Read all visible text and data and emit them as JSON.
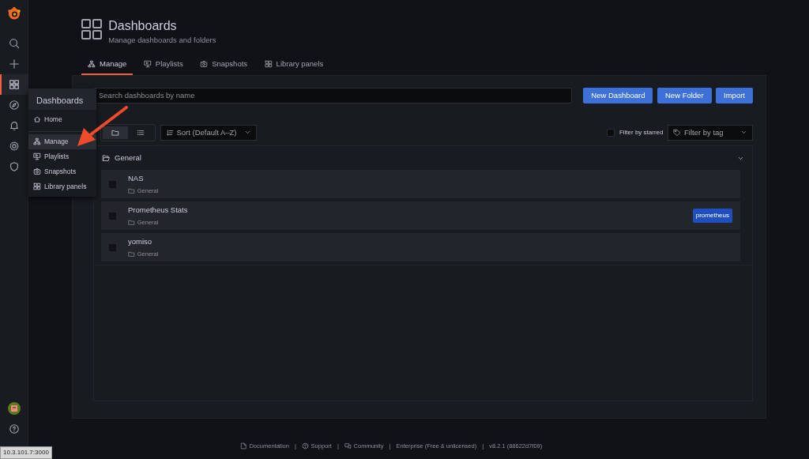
{
  "sidebar": {
    "items": [
      {
        "kind": "search",
        "selected": false
      },
      {
        "kind": "create",
        "selected": false
      },
      {
        "kind": "dashboards",
        "selected": true
      },
      {
        "kind": "explore",
        "selected": false
      },
      {
        "kind": "alerting",
        "selected": false
      },
      {
        "kind": "configuration",
        "selected": false
      },
      {
        "kind": "shield",
        "selected": false
      }
    ],
    "bottom": [
      {
        "kind": "avatar"
      },
      {
        "kind": "help"
      }
    ]
  },
  "flyout": {
    "title": "Dashboards",
    "items": [
      {
        "label": "Home",
        "kind": "home",
        "selected": false
      },
      {
        "label": "Manage",
        "kind": "manage",
        "selected": true
      },
      {
        "label": "Playlists",
        "kind": "playlists",
        "selected": false
      },
      {
        "label": "Snapshots",
        "kind": "snapshots",
        "selected": false
      },
      {
        "label": "Library panels",
        "kind": "library",
        "selected": false
      }
    ]
  },
  "page_header": {
    "title": "Dashboards",
    "subtitle": "Manage dashboards and folders"
  },
  "tabs": [
    {
      "label": "Manage",
      "kind": "manage",
      "selected": true
    },
    {
      "label": "Playlists",
      "kind": "playlists",
      "selected": false
    },
    {
      "label": "Snapshots",
      "kind": "snapshots",
      "selected": false
    },
    {
      "label": "Library panels",
      "kind": "library",
      "selected": false
    }
  ],
  "search": {
    "placeholder": "Search dashboards by name"
  },
  "buttons": [
    "New Dashboard",
    "New Folder",
    "Import"
  ],
  "view_modes": [
    {
      "kind": "folders",
      "selected": true
    },
    {
      "kind": "list",
      "selected": false
    }
  ],
  "sort": {
    "value": "Sort (Default A–Z)"
  },
  "filter_starred": {
    "label": "Filter by starred",
    "checked": false
  },
  "tag_filter": {
    "placeholder": "Filter by tag"
  },
  "folder": {
    "name": "General",
    "expanded": true,
    "dashboards": [
      {
        "title": "NAS",
        "folder": "General",
        "checked": false
      },
      {
        "title": "Prometheus Stats",
        "folder": "General",
        "checked": false,
        "tags": [
          "prometheus"
        ]
      },
      {
        "title": "yomiso",
        "folder": "General",
        "checked": false
      }
    ]
  },
  "footer": [
    {
      "label": "Documentation",
      "kind": "doc"
    },
    {
      "label": "|",
      "kind": "separator"
    },
    {
      "label": "Support",
      "kind": "help"
    },
    {
      "label": "|",
      "kind": "separator"
    },
    {
      "label": "Community",
      "kind": "chat"
    },
    {
      "label": "|",
      "kind": "separator"
    },
    {
      "label": "Enterprise (Free & unlicensed)",
      "kind": "text"
    },
    {
      "label": "|",
      "kind": "separator"
    },
    {
      "label": "v8.2.1 (88622d7f09)",
      "kind": "text"
    }
  ],
  "status_url": "10.3.101.7:3000"
}
